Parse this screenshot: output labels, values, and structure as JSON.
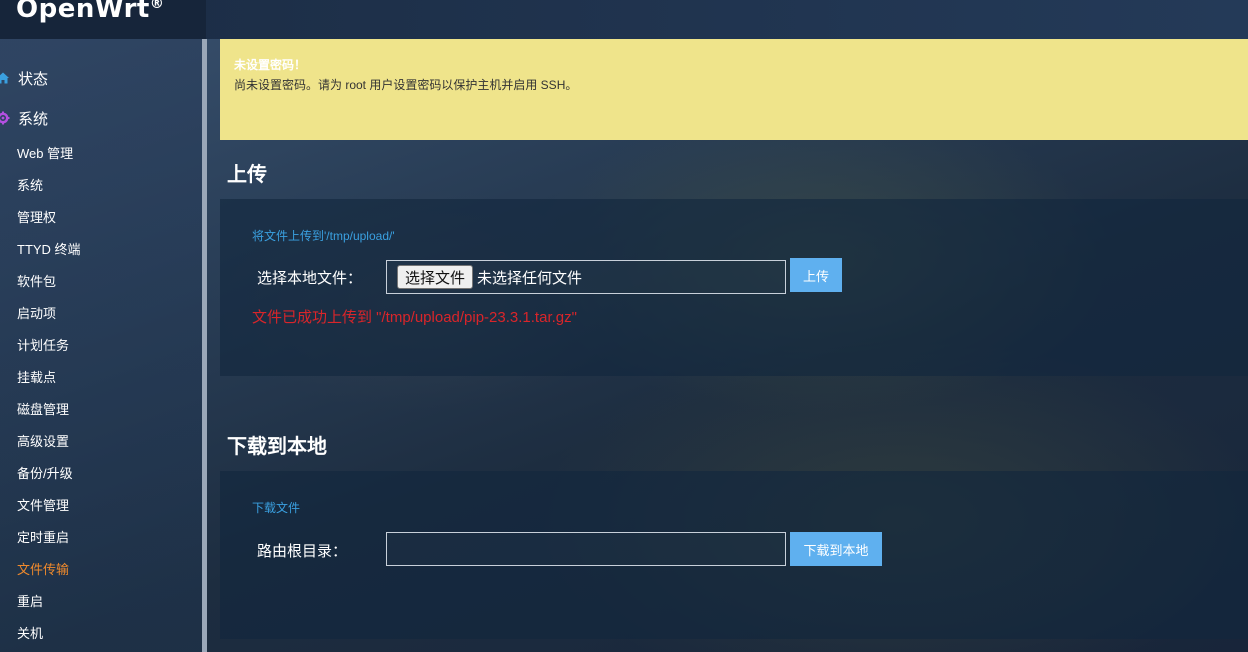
{
  "brand": {
    "name": "OpenWrt",
    "reg": "®"
  },
  "sidebar": {
    "top_items": [
      {
        "label": "状态",
        "icon": "home-icon"
      },
      {
        "label": "系统",
        "icon": "gear-icon"
      }
    ],
    "sub_items": [
      {
        "label": "Web 管理"
      },
      {
        "label": "系统"
      },
      {
        "label": "管理权"
      },
      {
        "label": "TTYD 终端"
      },
      {
        "label": "软件包"
      },
      {
        "label": "启动项"
      },
      {
        "label": "计划任务"
      },
      {
        "label": "挂载点"
      },
      {
        "label": "磁盘管理"
      },
      {
        "label": "高级设置"
      },
      {
        "label": "备份/升级"
      },
      {
        "label": "文件管理"
      },
      {
        "label": "定时重启"
      },
      {
        "label": "文件传输",
        "active": true
      },
      {
        "label": "重启"
      },
      {
        "label": "关机"
      }
    ]
  },
  "alert": {
    "title": "未设置密码！",
    "text": "尚未设置密码。请为 root 用户设置密码以保护主机并启用 SSH。"
  },
  "upload": {
    "title": "上传",
    "description": "将文件上传到'/tmp/upload/'",
    "label": "选择本地文件：",
    "choose_button": "选择文件",
    "file_status": "未选择任何文件",
    "submit_button": "上传",
    "success_message": "文件已成功上传到 \"/tmp/upload/pip-23.3.1.tar.gz\""
  },
  "download": {
    "title": "下载到本地",
    "description": "下载文件",
    "label": "路由根目录：",
    "input_value": "",
    "submit_button": "下载到本地"
  },
  "colors": {
    "accent": "#5fb0ef",
    "active_menu": "#f08a2c",
    "alert_bg": "#efe48b",
    "error": "#d9252a",
    "link": "#3aa0e0"
  }
}
